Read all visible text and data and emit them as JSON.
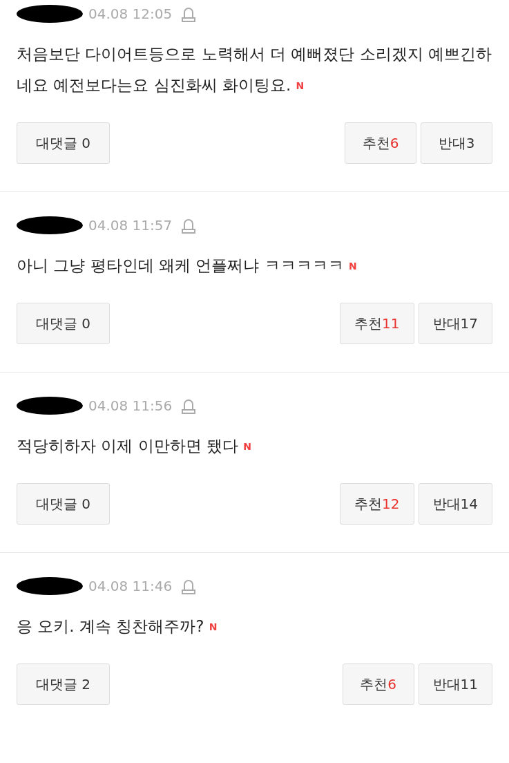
{
  "comments": [
    {
      "time": "04.08 12:05",
      "text": "처음보단 다이어트등으로 노력해서 더 예뻐졌단 소리겠지 예쁘긴하네요 예전보다는요 심진화씨 화이팅요.",
      "new_badge": "N",
      "reply_label": "대댓글 0",
      "like_label": "추천",
      "like_count": "6",
      "dislike_label": "반대3"
    },
    {
      "time": "04.08 11:57",
      "text": "아니 그냥 평타인데 왜케 언플쩌냐 ㅋㅋㅋㅋㅋ",
      "new_badge": "N",
      "reply_label": "대댓글 0",
      "like_label": "추천",
      "like_count": "11",
      "dislike_label": "반대17"
    },
    {
      "time": "04.08 11:56",
      "text": "적당히하자 이제 이만하면 됐다",
      "new_badge": "N",
      "reply_label": "대댓글 0",
      "like_label": "추천",
      "like_count": "12",
      "dislike_label": "반대14"
    },
    {
      "time": "04.08 11:46",
      "text": "응 오키. 계속 칭찬해주까?",
      "new_badge": "N",
      "reply_label": "대댓글 2",
      "like_label": "추천",
      "like_count": "6",
      "dislike_label": "반대11"
    }
  ]
}
